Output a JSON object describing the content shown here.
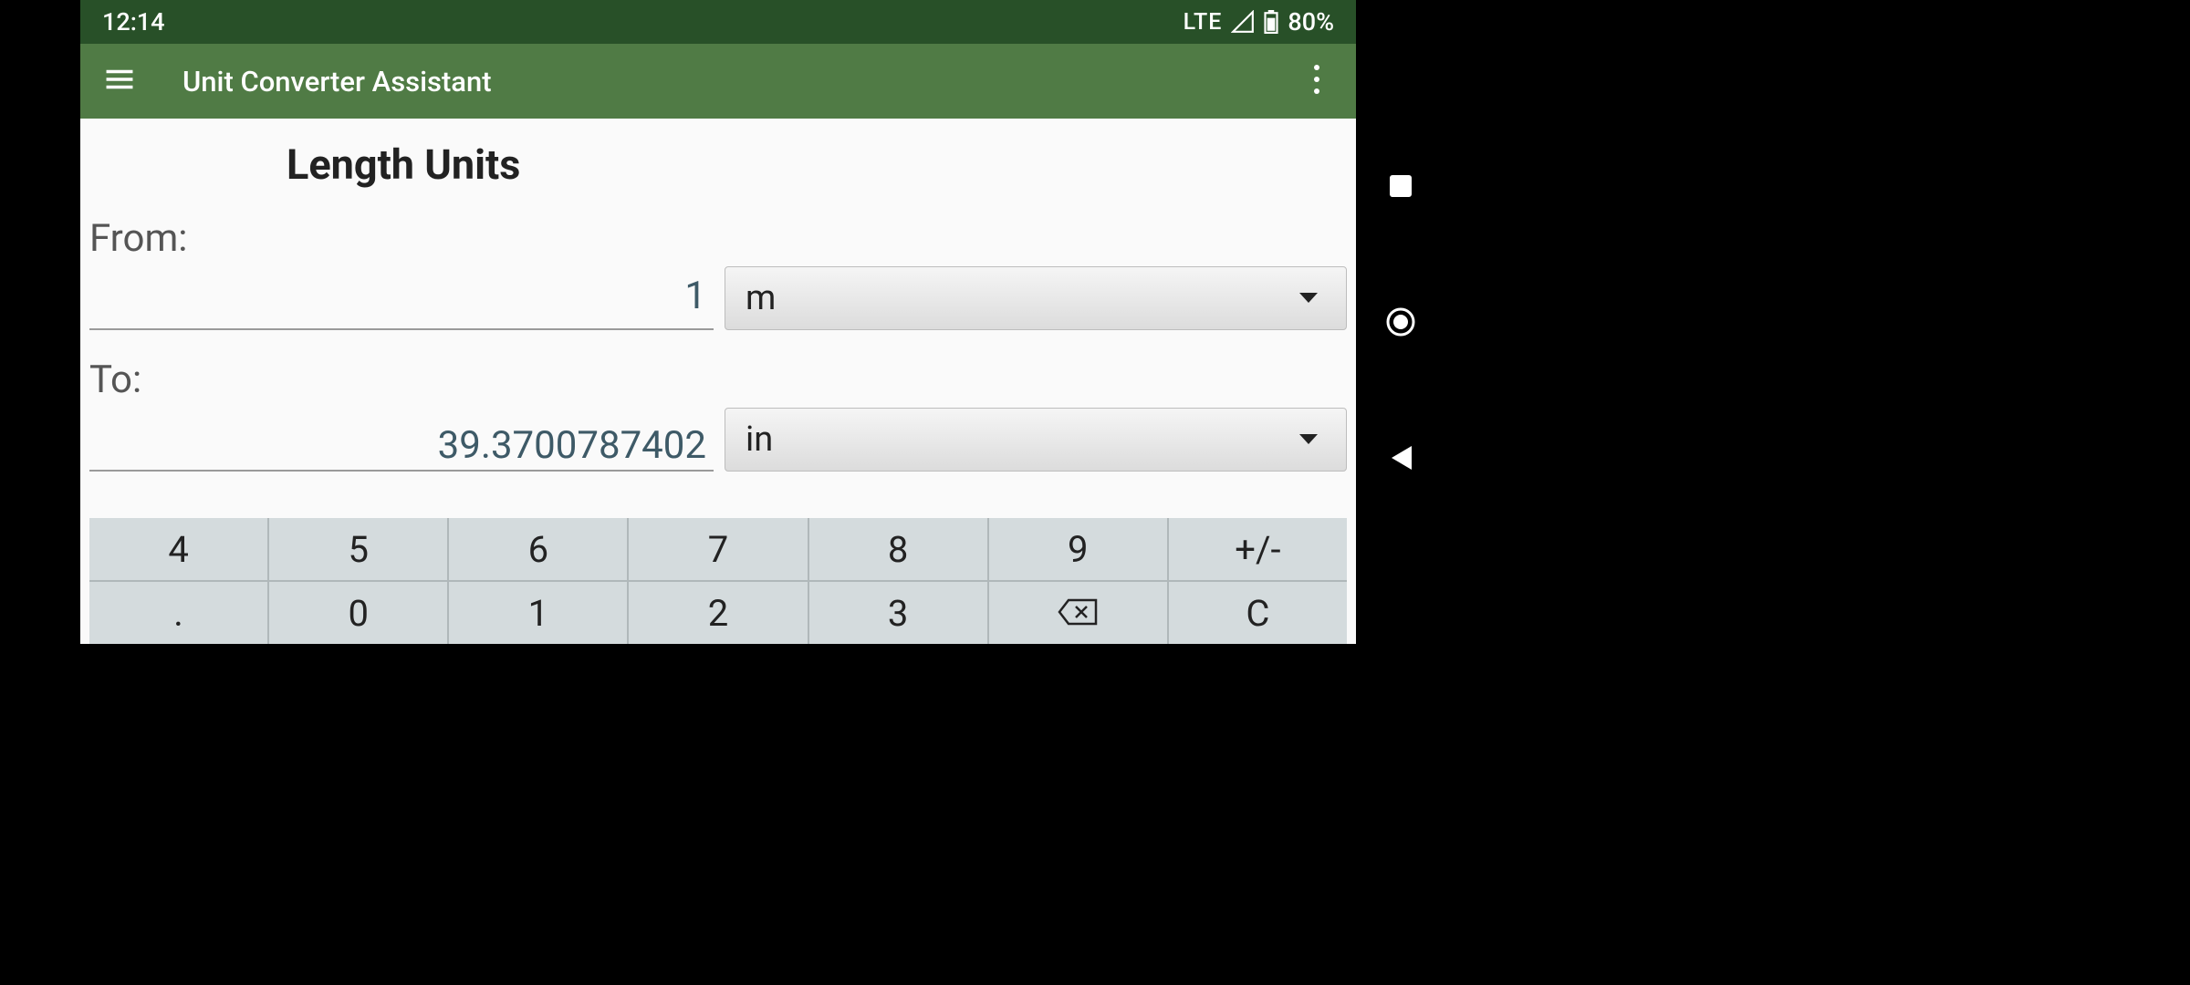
{
  "status": {
    "time": "12:14",
    "network": "LTE",
    "battery": "80%"
  },
  "app": {
    "title": "Unit Converter Assistant"
  },
  "section": {
    "title": "Length Units",
    "from_label": "From:",
    "to_label": "To:",
    "from_value": "1",
    "from_unit": "m",
    "to_value": "39.3700787402",
    "to_unit": "in"
  },
  "keypad": {
    "row1": [
      "4",
      "5",
      "6",
      "7",
      "8",
      "9",
      "+/-"
    ],
    "row2": [
      ".",
      "0",
      "1",
      "2",
      "3",
      "⌫",
      "C"
    ]
  }
}
